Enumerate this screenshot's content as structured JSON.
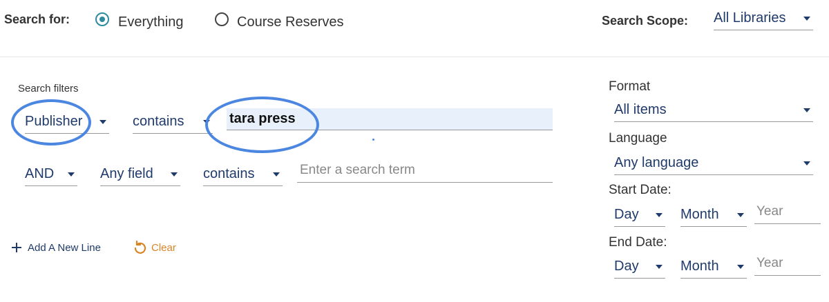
{
  "search_for": {
    "label": "Search for:",
    "options": [
      {
        "label": "Everything",
        "selected": true
      },
      {
        "label": "Course Reserves",
        "selected": false
      }
    ]
  },
  "search_scope": {
    "label": "Search Scope:",
    "value": "All Libraries"
  },
  "filters": {
    "heading": "Search filters",
    "row1": {
      "field": "Publisher",
      "operator": "contains",
      "term": "tara press"
    },
    "row2": {
      "boolean": "AND",
      "field": "Any field",
      "operator": "contains",
      "placeholder": "Enter a search term"
    },
    "add_line": "Add A New Line",
    "clear": "Clear"
  },
  "sidebar": {
    "format_label": "Format",
    "format_value": "All items",
    "language_label": "Language",
    "language_value": "Any language",
    "start_date_label": "Start Date:",
    "end_date_label": "End Date:",
    "day": "Day",
    "month": "Month",
    "year_placeholder": "Year"
  },
  "colors": {
    "accent": "#2c8c9e",
    "annotation": "#4b86e0",
    "clear": "#d98324",
    "text_blue": "#1f3a6b"
  }
}
